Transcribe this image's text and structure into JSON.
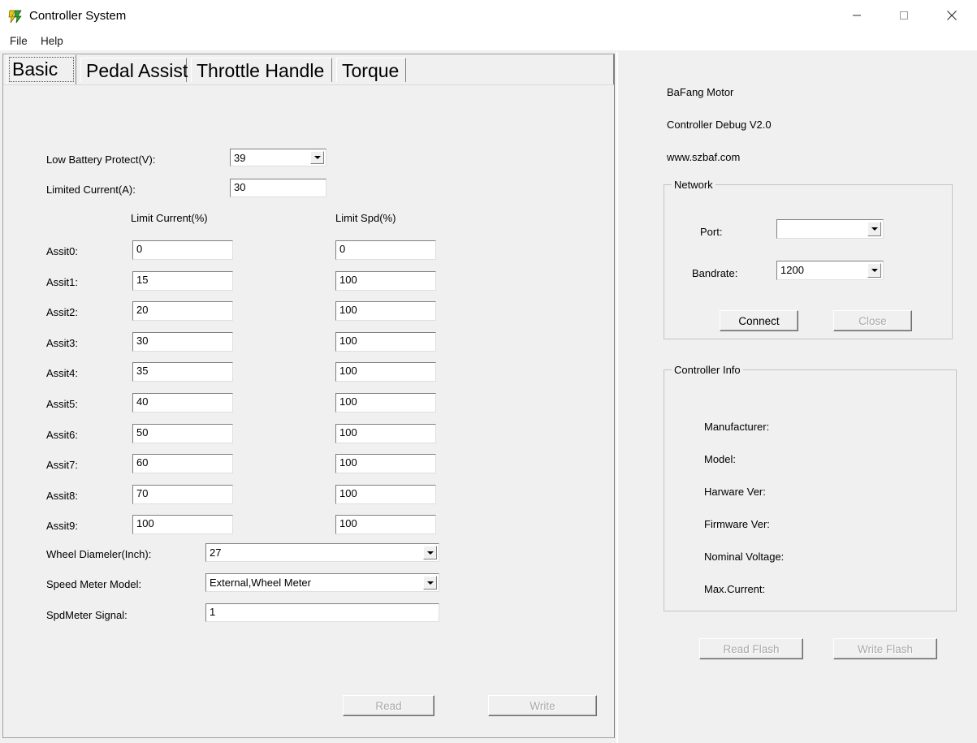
{
  "window": {
    "title": "Controller System",
    "icon": "app-icon",
    "controls": {
      "minimize": "minimize-icon",
      "maximize": "maximize-icon",
      "close": "close-icon"
    }
  },
  "menu": {
    "items": [
      {
        "label": "File"
      },
      {
        "label": "Help"
      }
    ]
  },
  "tabs": [
    {
      "label": "Basic",
      "active": true
    },
    {
      "label": "Pedal Assist",
      "active": false
    },
    {
      "label": "Throttle Handle",
      "active": false
    },
    {
      "label": "Torque",
      "active": false
    }
  ],
  "basic": {
    "low_battery_protect": {
      "label": "Low Battery Protect(V):",
      "value": "39"
    },
    "limited_current": {
      "label": "Limited Current(A):",
      "value": "30"
    },
    "columns": {
      "limit_current": "Limit Current(%)",
      "limit_spd": "Limit Spd(%)"
    },
    "assist_rows": [
      {
        "label": "Assit0:",
        "limit_current": "0",
        "limit_spd": "0"
      },
      {
        "label": "Assit1:",
        "limit_current": "15",
        "limit_spd": "100"
      },
      {
        "label": "Assit2:",
        "limit_current": "20",
        "limit_spd": "100"
      },
      {
        "label": "Assit3:",
        "limit_current": "30",
        "limit_spd": "100"
      },
      {
        "label": "Assit4:",
        "limit_current": "35",
        "limit_spd": "100"
      },
      {
        "label": "Assit5:",
        "limit_current": "40",
        "limit_spd": "100"
      },
      {
        "label": "Assit6:",
        "limit_current": "50",
        "limit_spd": "100"
      },
      {
        "label": "Assit7:",
        "limit_current": "60",
        "limit_spd": "100"
      },
      {
        "label": "Assit8:",
        "limit_current": "70",
        "limit_spd": "100"
      },
      {
        "label": "Assit9:",
        "limit_current": "100",
        "limit_spd": "100"
      }
    ],
    "wheel_diameter": {
      "label": "Wheel Diameler(Inch):",
      "value": "27"
    },
    "speed_meter_model": {
      "label": "Speed Meter Model:",
      "value": "External,Wheel Meter"
    },
    "spdmeter_signal": {
      "label": "SpdMeter Signal:",
      "value": "1"
    },
    "read_button": {
      "label": "Read",
      "enabled": false
    },
    "write_button": {
      "label": "Write",
      "enabled": false
    }
  },
  "side": {
    "brand": "BaFang Motor",
    "product": "Controller Debug V2.0",
    "website": "www.szbaf.com",
    "network": {
      "title": "Network",
      "port": {
        "label": "Port:",
        "value": ""
      },
      "bandrate": {
        "label": "Bandrate:",
        "value": "1200"
      },
      "connect_button": {
        "label": "Connect",
        "enabled": true
      },
      "close_button": {
        "label": "Close",
        "enabled": false
      }
    },
    "controller_info": {
      "title": "Controller Info",
      "fields": [
        {
          "label": "Manufacturer:",
          "value": ""
        },
        {
          "label": "Model:",
          "value": ""
        },
        {
          "label": "Harware Ver:",
          "value": ""
        },
        {
          "label": "Firmware Ver:",
          "value": ""
        },
        {
          "label": "Nominal Voltage:",
          "value": ""
        },
        {
          "label": "Max.Current:",
          "value": ""
        }
      ]
    },
    "read_flash_button": {
      "label": "Read Flash",
      "enabled": false
    },
    "write_flash_button": {
      "label": "Write Flash",
      "enabled": false
    }
  },
  "colors": {
    "window_bg": "#f0f0f0",
    "titlebar_bg": "#ffffff",
    "field_bg": "#ffffff",
    "border": "#808080",
    "disabled_text": "#a8a8a8"
  }
}
